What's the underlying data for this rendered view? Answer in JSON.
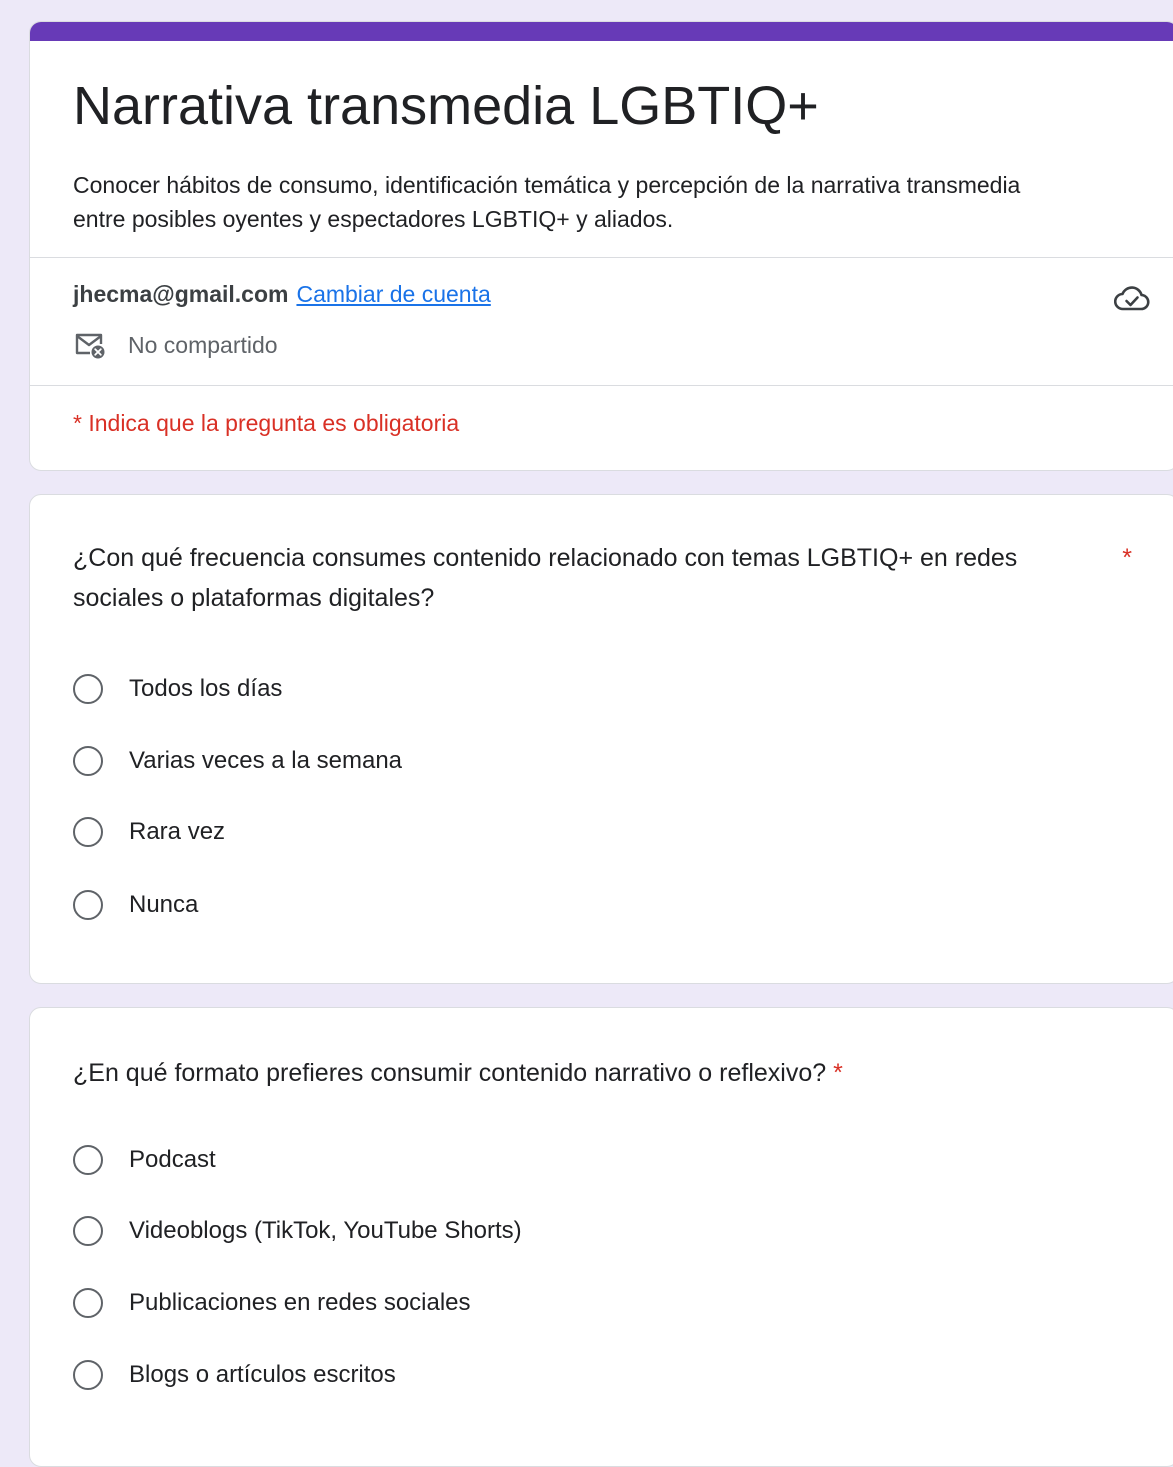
{
  "colors": {
    "background": "#ede9f8",
    "accent": "#673ab7",
    "link": "#1a73e8",
    "required": "#d93025"
  },
  "header": {
    "title": "Narrativa transmedia LGBTIQ+",
    "description": " Conocer hábitos de consumo, identificación temática y percepción de la narrativa transmedia entre posibles oyentes y espectadores LGBTIQ+ y aliados.",
    "account_email": "jhecma@gmail.com",
    "switch_account_label": "Cambiar de cuenta",
    "sharing_status": "No compartido",
    "sharing_icon": "mail-off-icon",
    "saved_status_icon": "cloud-check-icon",
    "required_note": "* Indica que la pregunta es obligatoria"
  },
  "questions": [
    {
      "text": "¿Con qué frecuencia consumes contenido relacionado con temas LGBTIQ+ en redes sociales o plataformas digitales?",
      "required_mark": "*",
      "options": [
        "Todos los días",
        "Varias veces a la semana",
        "Rara vez",
        "Nunca"
      ]
    },
    {
      "text": "¿En qué formato prefieres consumir contenido narrativo o reflexivo?",
      "required_mark": "*",
      "options": [
        "Podcast",
        "Videoblogs (TikTok, YouTube Shorts)",
        "Publicaciones en redes sociales",
        "Blogs o artículos escritos"
      ]
    }
  ]
}
